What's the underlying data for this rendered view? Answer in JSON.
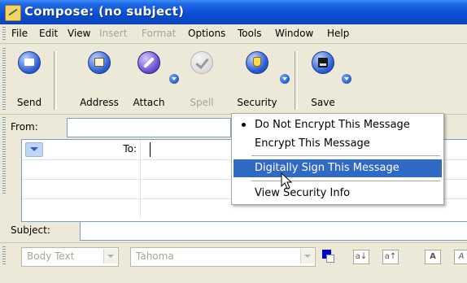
{
  "window": {
    "title": "Compose: (no subject)"
  },
  "menubar": {
    "items": [
      {
        "label": "File",
        "enabled": true
      },
      {
        "label": "Edit",
        "enabled": true
      },
      {
        "label": "View",
        "enabled": true
      },
      {
        "label": "Insert",
        "enabled": false
      },
      {
        "label": "Format",
        "enabled": false
      },
      {
        "label": "Options",
        "enabled": true
      },
      {
        "label": "Tools",
        "enabled": true
      },
      {
        "label": "Window",
        "enabled": true
      },
      {
        "label": "Help",
        "enabled": true
      }
    ]
  },
  "toolbar": {
    "send": "Send",
    "address": "Address",
    "attach": "Attach",
    "spell": "Spell",
    "security": "Security",
    "save": "Save"
  },
  "header_fields": {
    "from_label": "From:",
    "from_value": "",
    "to_label": "To:",
    "to_value": "",
    "subject_label": "Subject:",
    "subject_value": ""
  },
  "format_toolbar": {
    "paragraph_style": "Body Text",
    "font": "Tahoma"
  },
  "security_menu": {
    "items": [
      {
        "label": "Do Not Encrypt This Message",
        "checked": true
      },
      {
        "label": "Encrypt This Message",
        "checked": false
      },
      {
        "label": "Digitally Sign This Message",
        "checked": false,
        "highlighted": true
      },
      {
        "label": "View Security Info",
        "checked": false
      }
    ]
  },
  "colors": {
    "title_bar": "#0a4fd6",
    "menu_highlight": "#316ac5",
    "window_face": "#ece9d8",
    "text_color_swatch": "#0000cc"
  }
}
